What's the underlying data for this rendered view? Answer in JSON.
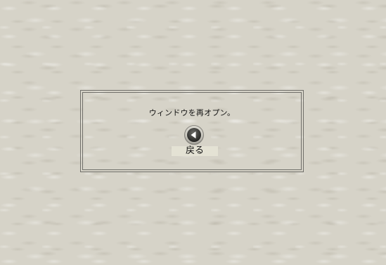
{
  "dialog": {
    "message": "ウィンドウを再オプン。",
    "back_button": {
      "icon": "arrow-left-circle-icon",
      "label": "戻る"
    }
  },
  "colors": {
    "background": "#d6d3c8",
    "border": "#6f6e69",
    "label_bg": "#e4e2d4"
  }
}
